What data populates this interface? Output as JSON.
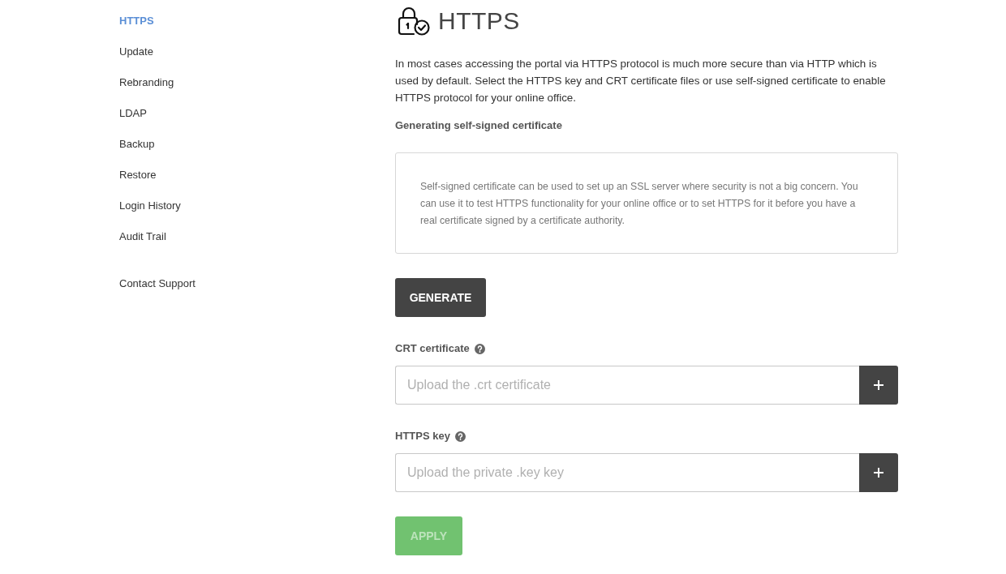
{
  "sidebar": {
    "items": [
      {
        "label": "HTTPS",
        "selected": true
      },
      {
        "label": "Update",
        "selected": false
      },
      {
        "label": "Rebranding",
        "selected": false
      },
      {
        "label": "LDAP",
        "selected": false
      },
      {
        "label": "Backup",
        "selected": false
      },
      {
        "label": "Restore",
        "selected": false
      },
      {
        "label": "Login History",
        "selected": false
      },
      {
        "label": "Audit Trail",
        "selected": false
      }
    ],
    "support_link": "Contact Support"
  },
  "header": {
    "title": "HTTPS"
  },
  "intro": "In most cases accessing the portal via HTTPS protocol is much more secure than via HTTP which is used by default. Select the HTTPS key and CRT certificate files or use self-signed certificate to enable HTTPS protocol for your online office.",
  "section_title": "Generating self-signed certificate",
  "info_box": "Self-signed certificate can be used to set up an SSL server where security is not a big concern. You can use it to test HTTPS functionality for your online office or to set HTTPS for it before you have a real certificate signed by a certificate authority.",
  "generate_button": "GENERATE",
  "fields": [
    {
      "label": "CRT certificate",
      "placeholder": "Upload the .crt certificate"
    },
    {
      "label": "HTTPS key",
      "placeholder": "Upload the private .key key"
    }
  ],
  "apply_button": {
    "label": "APPLY",
    "disabled": true
  }
}
